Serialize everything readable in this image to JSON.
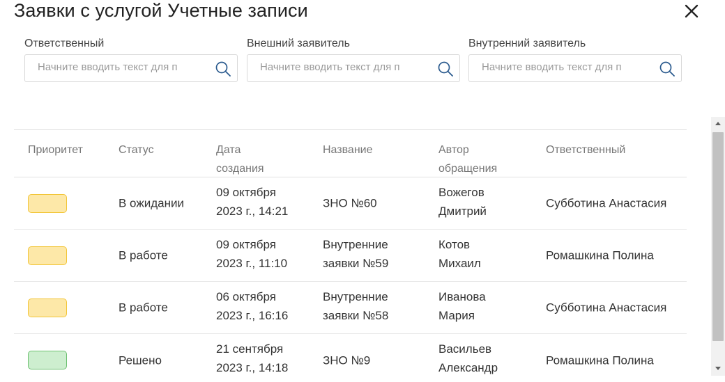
{
  "dialog": {
    "title": "Заявки с услугой Учетные записи"
  },
  "filters": [
    {
      "label": "Ответственный",
      "placeholder": "Начните вводить текст для п",
      "value": ""
    },
    {
      "label": "Внешний заявитель",
      "placeholder": "Начните вводить текст для п",
      "value": ""
    },
    {
      "label": "Внутренний заявитель",
      "placeholder": "Начните вводить текст для п",
      "value": ""
    }
  ],
  "table": {
    "columns": [
      "Приоритет",
      "Статус",
      "Дата создания",
      "Название",
      "Автор обращения",
      "Ответственный"
    ],
    "column_lines": [
      [
        "Приоритет"
      ],
      [
        "Статус"
      ],
      [
        "Дата",
        "создания"
      ],
      [
        "Название"
      ],
      [
        "Автор",
        "обращения"
      ],
      [
        "Ответственный"
      ]
    ],
    "rows": [
      {
        "priority": "medium",
        "status": "В ожидании",
        "created": [
          "09 октября",
          "2023 г., 14:21"
        ],
        "name": [
          "ЗНО №60"
        ],
        "author": [
          "Вожегов",
          "Дмитрий"
        ],
        "responsible": "Субботина Анастасия"
      },
      {
        "priority": "medium",
        "status": "В работе",
        "created": [
          "09 октября",
          "2023 г., 11:10"
        ],
        "name": [
          "Внутренние",
          "заявки №59"
        ],
        "author": [
          "Котов",
          "Михаил"
        ],
        "responsible": "Ромашкина Полина"
      },
      {
        "priority": "medium",
        "status": "В работе",
        "created": [
          "06 октября",
          "2023 г., 16:16"
        ],
        "name": [
          "Внутренние",
          "заявки №58"
        ],
        "author": [
          "Иванова",
          "Мария"
        ],
        "responsible": "Субботина Анастасия"
      },
      {
        "priority": "low",
        "status": "Решено",
        "created": [
          "21 сентября",
          "2023 г., 14:18"
        ],
        "name": [
          "ЗНО №9"
        ],
        "author": [
          "Васильев",
          "Александр"
        ],
        "responsible": "Ромашкина Полина"
      }
    ]
  },
  "colors": {
    "priority_medium_fill": "#fde8a8",
    "priority_medium_border": "#f2c537",
    "priority_low_fill": "#cdeecf",
    "priority_low_border": "#6cc070",
    "link": "#2a5a8e"
  },
  "icons": {
    "close": "close-icon",
    "search": "search-icon",
    "scroll_up": "chevron-up-icon",
    "scroll_down": "chevron-down-icon"
  }
}
